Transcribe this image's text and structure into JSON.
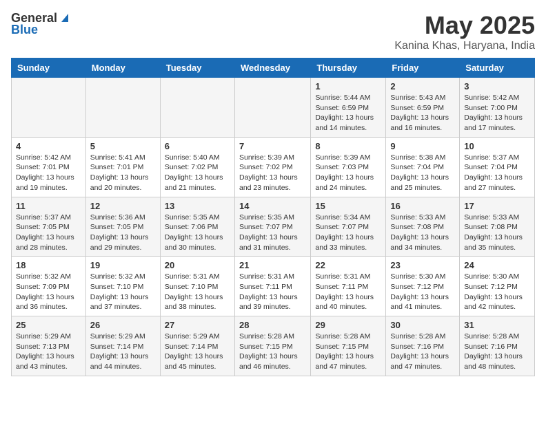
{
  "header": {
    "logo_general": "General",
    "logo_blue": "Blue",
    "month_title": "May 2025",
    "location": "Kanina Khas, Haryana, India"
  },
  "days_of_week": [
    "Sunday",
    "Monday",
    "Tuesday",
    "Wednesday",
    "Thursday",
    "Friday",
    "Saturday"
  ],
  "weeks": [
    [
      {
        "day": "",
        "info": ""
      },
      {
        "day": "",
        "info": ""
      },
      {
        "day": "",
        "info": ""
      },
      {
        "day": "",
        "info": ""
      },
      {
        "day": "1",
        "info": "Sunrise: 5:44 AM\nSunset: 6:59 PM\nDaylight: 13 hours\nand 14 minutes."
      },
      {
        "day": "2",
        "info": "Sunrise: 5:43 AM\nSunset: 6:59 PM\nDaylight: 13 hours\nand 16 minutes."
      },
      {
        "day": "3",
        "info": "Sunrise: 5:42 AM\nSunset: 7:00 PM\nDaylight: 13 hours\nand 17 minutes."
      }
    ],
    [
      {
        "day": "4",
        "info": "Sunrise: 5:42 AM\nSunset: 7:01 PM\nDaylight: 13 hours\nand 19 minutes."
      },
      {
        "day": "5",
        "info": "Sunrise: 5:41 AM\nSunset: 7:01 PM\nDaylight: 13 hours\nand 20 minutes."
      },
      {
        "day": "6",
        "info": "Sunrise: 5:40 AM\nSunset: 7:02 PM\nDaylight: 13 hours\nand 21 minutes."
      },
      {
        "day": "7",
        "info": "Sunrise: 5:39 AM\nSunset: 7:02 PM\nDaylight: 13 hours\nand 23 minutes."
      },
      {
        "day": "8",
        "info": "Sunrise: 5:39 AM\nSunset: 7:03 PM\nDaylight: 13 hours\nand 24 minutes."
      },
      {
        "day": "9",
        "info": "Sunrise: 5:38 AM\nSunset: 7:04 PM\nDaylight: 13 hours\nand 25 minutes."
      },
      {
        "day": "10",
        "info": "Sunrise: 5:37 AM\nSunset: 7:04 PM\nDaylight: 13 hours\nand 27 minutes."
      }
    ],
    [
      {
        "day": "11",
        "info": "Sunrise: 5:37 AM\nSunset: 7:05 PM\nDaylight: 13 hours\nand 28 minutes."
      },
      {
        "day": "12",
        "info": "Sunrise: 5:36 AM\nSunset: 7:05 PM\nDaylight: 13 hours\nand 29 minutes."
      },
      {
        "day": "13",
        "info": "Sunrise: 5:35 AM\nSunset: 7:06 PM\nDaylight: 13 hours\nand 30 minutes."
      },
      {
        "day": "14",
        "info": "Sunrise: 5:35 AM\nSunset: 7:07 PM\nDaylight: 13 hours\nand 31 minutes."
      },
      {
        "day": "15",
        "info": "Sunrise: 5:34 AM\nSunset: 7:07 PM\nDaylight: 13 hours\nand 33 minutes."
      },
      {
        "day": "16",
        "info": "Sunrise: 5:33 AM\nSunset: 7:08 PM\nDaylight: 13 hours\nand 34 minutes."
      },
      {
        "day": "17",
        "info": "Sunrise: 5:33 AM\nSunset: 7:08 PM\nDaylight: 13 hours\nand 35 minutes."
      }
    ],
    [
      {
        "day": "18",
        "info": "Sunrise: 5:32 AM\nSunset: 7:09 PM\nDaylight: 13 hours\nand 36 minutes."
      },
      {
        "day": "19",
        "info": "Sunrise: 5:32 AM\nSunset: 7:10 PM\nDaylight: 13 hours\nand 37 minutes."
      },
      {
        "day": "20",
        "info": "Sunrise: 5:31 AM\nSunset: 7:10 PM\nDaylight: 13 hours\nand 38 minutes."
      },
      {
        "day": "21",
        "info": "Sunrise: 5:31 AM\nSunset: 7:11 PM\nDaylight: 13 hours\nand 39 minutes."
      },
      {
        "day": "22",
        "info": "Sunrise: 5:31 AM\nSunset: 7:11 PM\nDaylight: 13 hours\nand 40 minutes."
      },
      {
        "day": "23",
        "info": "Sunrise: 5:30 AM\nSunset: 7:12 PM\nDaylight: 13 hours\nand 41 minutes."
      },
      {
        "day": "24",
        "info": "Sunrise: 5:30 AM\nSunset: 7:12 PM\nDaylight: 13 hours\nand 42 minutes."
      }
    ],
    [
      {
        "day": "25",
        "info": "Sunrise: 5:29 AM\nSunset: 7:13 PM\nDaylight: 13 hours\nand 43 minutes."
      },
      {
        "day": "26",
        "info": "Sunrise: 5:29 AM\nSunset: 7:14 PM\nDaylight: 13 hours\nand 44 minutes."
      },
      {
        "day": "27",
        "info": "Sunrise: 5:29 AM\nSunset: 7:14 PM\nDaylight: 13 hours\nand 45 minutes."
      },
      {
        "day": "28",
        "info": "Sunrise: 5:28 AM\nSunset: 7:15 PM\nDaylight: 13 hours\nand 46 minutes."
      },
      {
        "day": "29",
        "info": "Sunrise: 5:28 AM\nSunset: 7:15 PM\nDaylight: 13 hours\nand 47 minutes."
      },
      {
        "day": "30",
        "info": "Sunrise: 5:28 AM\nSunset: 7:16 PM\nDaylight: 13 hours\nand 47 minutes."
      },
      {
        "day": "31",
        "info": "Sunrise: 5:28 AM\nSunset: 7:16 PM\nDaylight: 13 hours\nand 48 minutes."
      }
    ]
  ]
}
